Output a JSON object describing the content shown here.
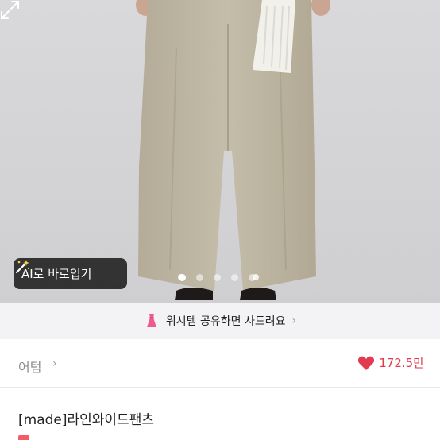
{
  "hero": {
    "ai_button_label": "AI로 바로입기",
    "carousel_total": 5,
    "carousel_active": 1
  },
  "wish_banner": {
    "text": "위시템 공유하면 사드려요"
  },
  "shop": {
    "name": "어텀"
  },
  "likes": {
    "count": "172.5만"
  },
  "product": {
    "title": "[made]라인와이드팬츠"
  },
  "colors": {
    "accent": "#e23a4e",
    "banner_bg": "#f3f3f5"
  }
}
